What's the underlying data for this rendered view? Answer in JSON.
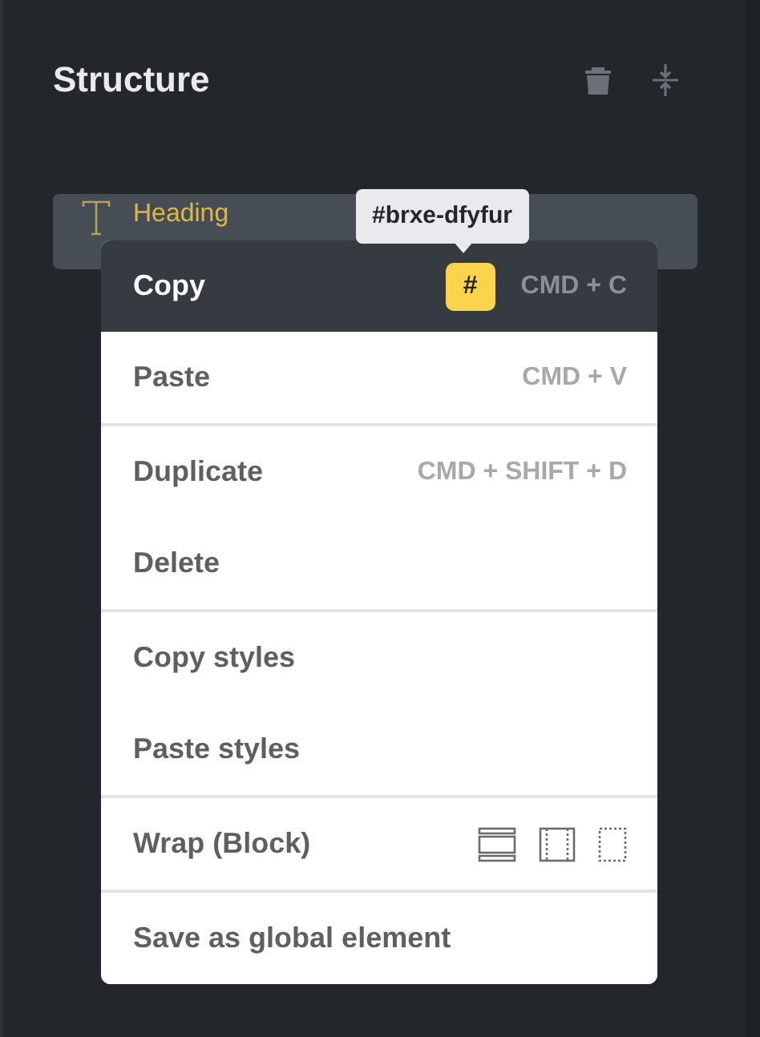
{
  "panel": {
    "title": "Structure"
  },
  "tree": [
    {
      "label": "Heading",
      "selected": true
    }
  ],
  "tooltip": {
    "text": "#brxe-dfyfur"
  },
  "menu": {
    "groups": [
      [
        {
          "label": "Copy",
          "selected": true,
          "badge": "#",
          "shortcut": "CMD + C"
        }
      ],
      [
        {
          "label": "Paste",
          "selected": false,
          "shortcut": "CMD + V"
        }
      ],
      [
        {
          "label": "Duplicate",
          "selected": false,
          "shortcut": "CMD + SHIFT + D"
        },
        {
          "label": "Delete",
          "selected": false
        }
      ],
      [
        {
          "label": "Copy styles",
          "selected": false
        },
        {
          "label": "Paste styles",
          "selected": false
        }
      ],
      [
        {
          "label": "Wrap (Block)",
          "selected": false,
          "kind": "wrap"
        }
      ],
      [
        {
          "label": "Save as global element",
          "selected": false
        }
      ]
    ]
  }
}
